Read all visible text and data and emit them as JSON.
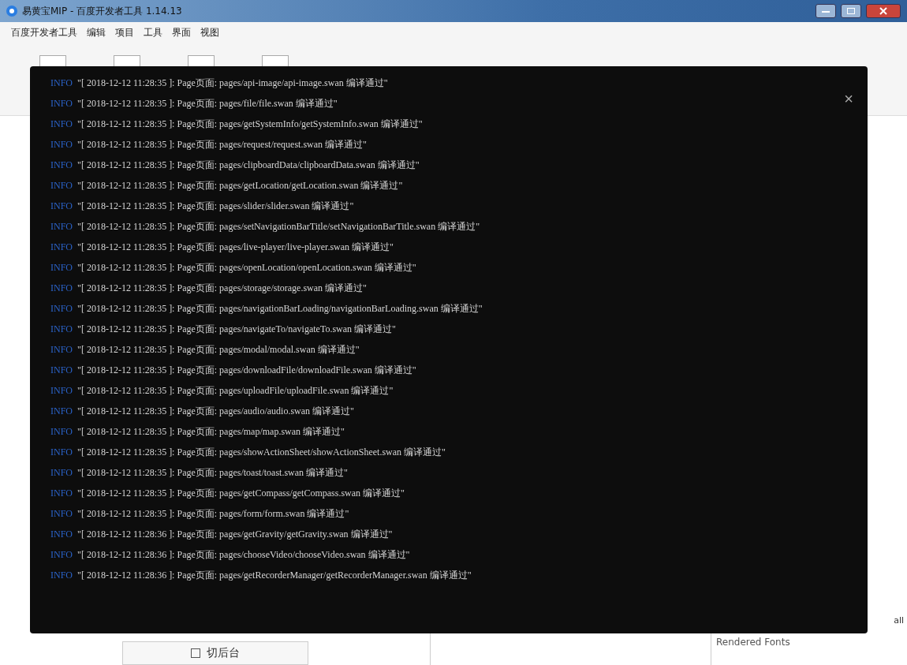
{
  "window": {
    "title": "易黄宝MIP - 百度开发者工具 1.14.13"
  },
  "menu": [
    "百度开发者工具",
    "编辑",
    "项目",
    "工具",
    "界面",
    "视图"
  ],
  "bottom": {
    "background_button": "切后台",
    "fonts_label": "Rendered Fonts",
    "right_label": "all"
  },
  "log_panel": {
    "close": "×",
    "entries": [
      {
        "level": "INFO",
        "message": "\"[ 2018-12-12 11:28:35 ]: Page页面: pages/api-image/api-image.swan 编译通过\""
      },
      {
        "level": "INFO",
        "message": "\"[ 2018-12-12 11:28:35 ]: Page页面: pages/file/file.swan 编译通过\""
      },
      {
        "level": "INFO",
        "message": "\"[ 2018-12-12 11:28:35 ]: Page页面: pages/getSystemInfo/getSystemInfo.swan 编译通过\""
      },
      {
        "level": "INFO",
        "message": "\"[ 2018-12-12 11:28:35 ]: Page页面: pages/request/request.swan 编译通过\""
      },
      {
        "level": "INFO",
        "message": "\"[ 2018-12-12 11:28:35 ]: Page页面: pages/clipboardData/clipboardData.swan 编译通过\""
      },
      {
        "level": "INFO",
        "message": "\"[ 2018-12-12 11:28:35 ]: Page页面: pages/getLocation/getLocation.swan 编译通过\""
      },
      {
        "level": "INFO",
        "message": "\"[ 2018-12-12 11:28:35 ]: Page页面: pages/slider/slider.swan 编译通过\""
      },
      {
        "level": "INFO",
        "message": "\"[ 2018-12-12 11:28:35 ]: Page页面: pages/setNavigationBarTitle/setNavigationBarTitle.swan 编译通过\""
      },
      {
        "level": "INFO",
        "message": "\"[ 2018-12-12 11:28:35 ]: Page页面: pages/live-player/live-player.swan 编译通过\""
      },
      {
        "level": "INFO",
        "message": "\"[ 2018-12-12 11:28:35 ]: Page页面: pages/openLocation/openLocation.swan 编译通过\""
      },
      {
        "level": "INFO",
        "message": "\"[ 2018-12-12 11:28:35 ]: Page页面: pages/storage/storage.swan 编译通过\""
      },
      {
        "level": "INFO",
        "message": "\"[ 2018-12-12 11:28:35 ]: Page页面: pages/navigationBarLoading/navigationBarLoading.swan 编译通过\""
      },
      {
        "level": "INFO",
        "message": "\"[ 2018-12-12 11:28:35 ]: Page页面: pages/navigateTo/navigateTo.swan 编译通过\""
      },
      {
        "level": "INFO",
        "message": "\"[ 2018-12-12 11:28:35 ]: Page页面: pages/modal/modal.swan 编译通过\""
      },
      {
        "level": "INFO",
        "message": "\"[ 2018-12-12 11:28:35 ]: Page页面: pages/downloadFile/downloadFile.swan 编译通过\""
      },
      {
        "level": "INFO",
        "message": "\"[ 2018-12-12 11:28:35 ]: Page页面: pages/uploadFile/uploadFile.swan 编译通过\""
      },
      {
        "level": "INFO",
        "message": "\"[ 2018-12-12 11:28:35 ]: Page页面: pages/audio/audio.swan 编译通过\""
      },
      {
        "level": "INFO",
        "message": "\"[ 2018-12-12 11:28:35 ]: Page页面: pages/map/map.swan 编译通过\""
      },
      {
        "level": "INFO",
        "message": "\"[ 2018-12-12 11:28:35 ]: Page页面: pages/showActionSheet/showActionSheet.swan 编译通过\""
      },
      {
        "level": "INFO",
        "message": "\"[ 2018-12-12 11:28:35 ]: Page页面: pages/toast/toast.swan 编译通过\""
      },
      {
        "level": "INFO",
        "message": "\"[ 2018-12-12 11:28:35 ]: Page页面: pages/getCompass/getCompass.swan 编译通过\""
      },
      {
        "level": "INFO",
        "message": "\"[ 2018-12-12 11:28:35 ]: Page页面: pages/form/form.swan 编译通过\""
      },
      {
        "level": "INFO",
        "message": "\"[ 2018-12-12 11:28:36 ]: Page页面: pages/getGravity/getGravity.swan 编译通过\""
      },
      {
        "level": "INFO",
        "message": "\"[ 2018-12-12 11:28:36 ]: Page页面: pages/chooseVideo/chooseVideo.swan 编译通过\""
      },
      {
        "level": "INFO",
        "message": "\"[ 2018-12-12 11:28:36 ]: Page页面: pages/getRecorderManager/getRecorderManager.swan 编译通过\""
      }
    ]
  }
}
